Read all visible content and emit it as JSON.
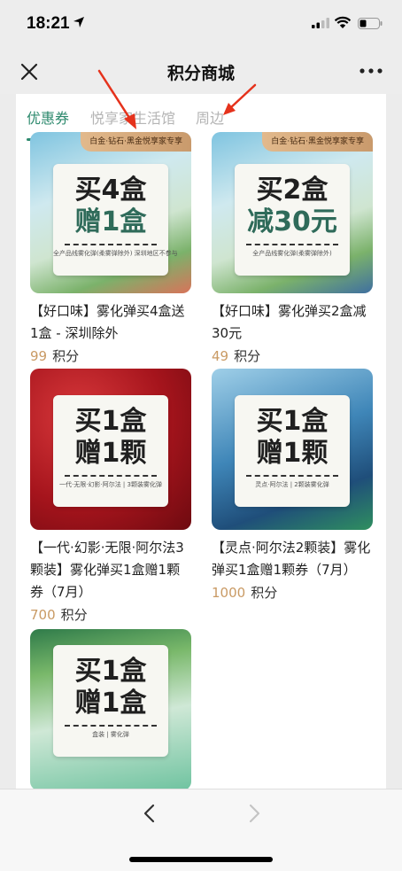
{
  "status_bar": {
    "time": "18:21",
    "icons": [
      "location-arrow-icon",
      "cellular-signal-icon",
      "wifi-icon",
      "battery-icon"
    ]
  },
  "nav": {
    "title": "积分商城",
    "close_icon": "close-icon",
    "more_icon": "more-icon"
  },
  "tabs": [
    {
      "label": "优惠券",
      "active": true
    },
    {
      "label": "悦享家生活馆",
      "active": false
    },
    {
      "label": "周边",
      "active": false
    }
  ],
  "colors": {
    "accent": "#2e8a6e",
    "points": "#c99a64",
    "annotation_arrow": "#e5321c"
  },
  "products": [
    {
      "ribbon": "白金·钻石·黑金悦享家专享",
      "promo_line1": "买4盒",
      "promo_line2": "赠1盒",
      "note": "全产品线雾化弹(柔雾弹除外)  深圳地区不参与",
      "title": "【好口味】雾化弹买4盒送1盒 - 深圳除外",
      "points": "99",
      "points_unit": "积分"
    },
    {
      "ribbon": "白金·钻石·黑金悦享家专享",
      "promo_line1": "买2盒",
      "promo_line2": "减30元",
      "note": "全产品线雾化弹(柔雾弹除外)",
      "title": "【好口味】雾化弹买2盒减30元",
      "points": "49",
      "points_unit": "积分"
    },
    {
      "promo_line1": "买1盒",
      "promo_line2": "赠1颗",
      "note": "一代·无限·幻影·阿尔法 | 3颗装雾化弹",
      "title": "【一代·幻影·无限·阿尔法3颗装】雾化弹买1盒赠1颗券（7月）",
      "points": "700",
      "points_unit": "积分"
    },
    {
      "promo_line1": "买1盒",
      "promo_line2": "赠1颗",
      "note": "灵点·阿尔法 | 2颗装雾化弹",
      "title": "【灵点·阿尔法2颗装】雾化弹买1盒赠1颗券（7月）",
      "points": "1000",
      "points_unit": "积分"
    },
    {
      "promo_line1": "买1盒",
      "promo_line2": "赠1盒",
      "note": "盒装 | 雾化弹"
    }
  ],
  "bottom_bar": {
    "back_icon": "chevron-left-icon",
    "forward_icon": "chevron-right-icon"
  }
}
